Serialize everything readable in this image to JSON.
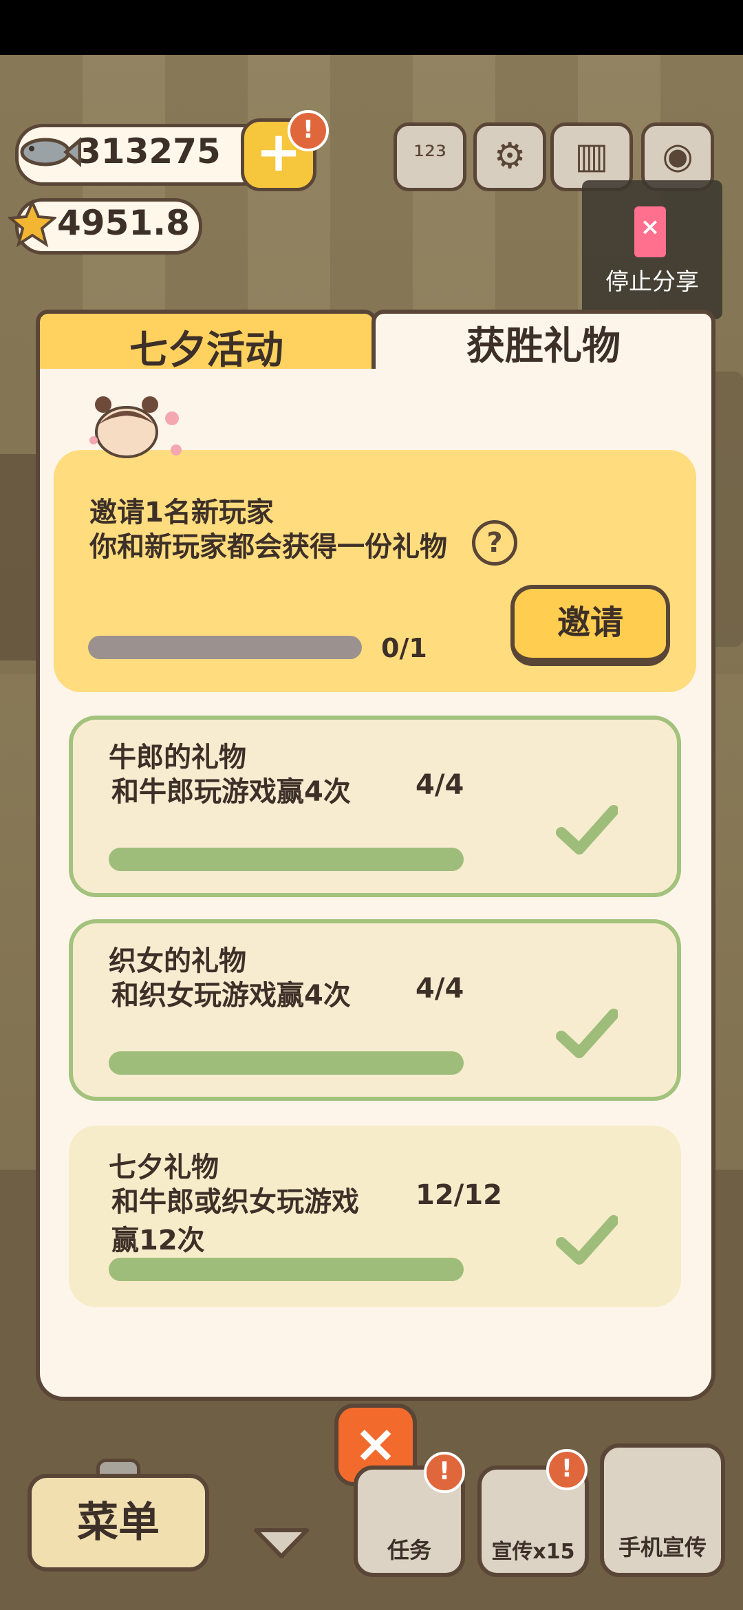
{
  "currency": {
    "fish": "313275",
    "stars": "4951.8",
    "alert": "!"
  },
  "share": {
    "label": "停止分享",
    "x": "×"
  },
  "tabs": [
    {
      "label": "七夕活动",
      "active": true
    },
    {
      "label": "获胜礼物",
      "active": false
    }
  ],
  "invite": {
    "line1": "邀请1名新玩家",
    "line2": "你和新玩家都会获得一份礼物",
    "help": "?",
    "progress_text": "0/1",
    "progress": 0,
    "button": "邀请"
  },
  "gifts": [
    {
      "title": "牛郎的礼物",
      "desc": "和牛郎玩游戏赢4次",
      "desc2": "",
      "count": "4/4",
      "progress": 1.0,
      "completed": true
    },
    {
      "title": "织女的礼物",
      "desc": "和织女玩游戏赢4次",
      "desc2": "",
      "count": "4/4",
      "progress": 1.0,
      "completed": true
    },
    {
      "title": "七夕礼物",
      "desc": "和牛郎或织女玩游戏",
      "desc2": "赢12次",
      "count": "12/12",
      "progress": 1.0,
      "completed": true
    }
  ],
  "bottom": {
    "menu": "菜单",
    "close": "×",
    "tasks": "任务",
    "promote": "宣传x15",
    "phone_promote": "手机宣传",
    "alert": "!"
  },
  "colors": {
    "accent": "#ffd15e",
    "panel": "#fdf5ea",
    "outline": "#5a4637",
    "complete_green": "#9fbd7a",
    "close_orange": "#f26a2c"
  }
}
